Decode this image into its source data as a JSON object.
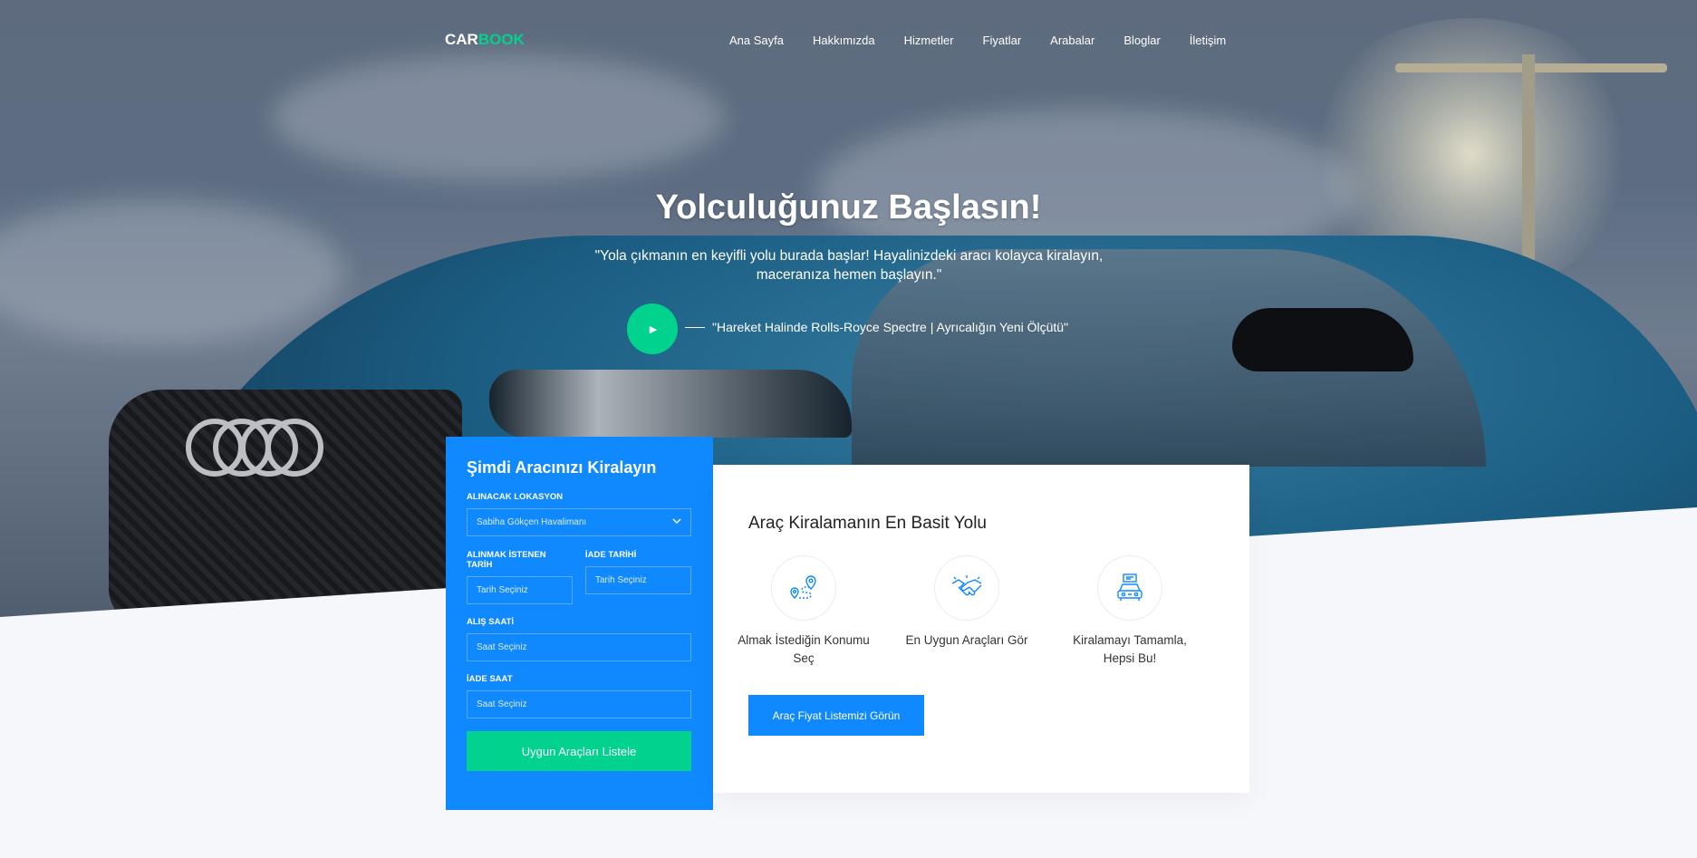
{
  "brand": {
    "part1": "CAR",
    "part2": "BOOK"
  },
  "nav": {
    "items": [
      "Ana Sayfa",
      "Hakkımızda",
      "Hizmetler",
      "Fiyatlar",
      "Arabalar",
      "Bloglar",
      "İletişim"
    ]
  },
  "hero": {
    "title": "Yolculuğunuz Başlasın!",
    "subtitle": "\"Yola çıkmanın en keyifli yolu burada başlar! Hayalinizdeki aracı kolayca kiralayın, maceranıza hemen başlayın.\"",
    "video_caption": "\"Hareket Halinde Rolls-Royce Spectre | Ayrıcalığın Yeni Ölçütü\""
  },
  "booking": {
    "title": "Şimdi Aracınızı Kiralayın",
    "location_label": "ALINACAK LOKASYON",
    "location_value": "Sabiha Gökçen Havalimanı",
    "pickup_date_label": "ALINMAK İSTENEN TARİH",
    "pickup_date_placeholder": "Tarih Seçiniz",
    "return_date_label": "İADE TARİHİ",
    "return_date_placeholder": "Tarih Seçiniz",
    "pickup_time_label": "ALIŞ SAATİ",
    "pickup_time_placeholder": "Saat Seçiniz",
    "return_time_label": "İADE SAAT",
    "return_time_placeholder": "Saat Seçiniz",
    "submit": "Uygun Araçları Listele"
  },
  "services": {
    "title": "Araç Kiralamanın En Basit Yolu",
    "items": [
      {
        "icon": "location-route-icon",
        "label": "Almak İstediğin Konumu Seç"
      },
      {
        "icon": "handshake-icon",
        "label": "En Uygun Araçları Gör"
      },
      {
        "icon": "car-booking-icon",
        "label": "Kiralamayı Tamamla, Hepsi Bu!"
      }
    ],
    "cta": "Araç Fiyat Listemizi Görün"
  },
  "colors": {
    "primary": "#1089ff",
    "accent": "#01d28e"
  }
}
